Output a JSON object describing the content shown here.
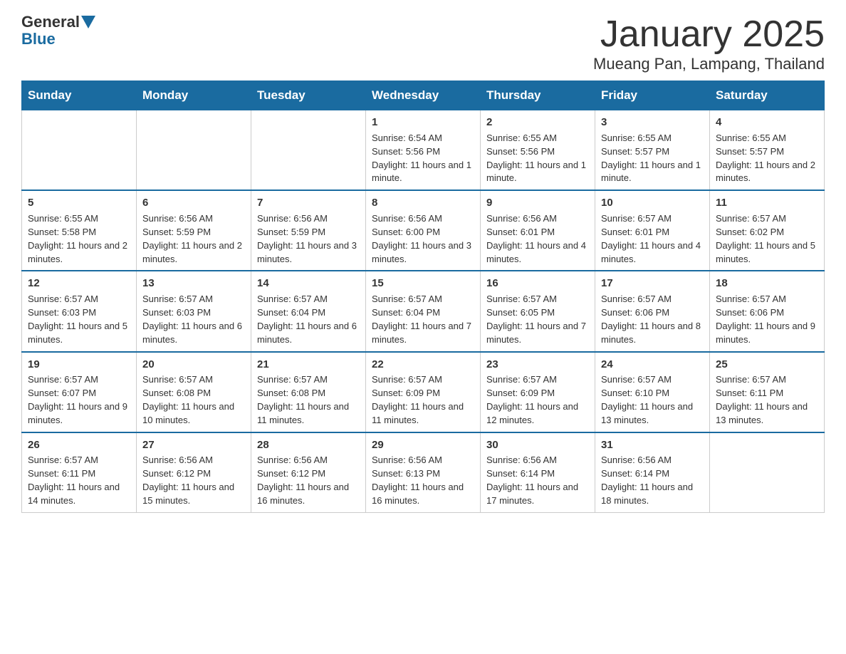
{
  "logo": {
    "general": "General",
    "blue": "Blue"
  },
  "title": "January 2025",
  "subtitle": "Mueang Pan, Lampang, Thailand",
  "weekdays": [
    "Sunday",
    "Monday",
    "Tuesday",
    "Wednesday",
    "Thursday",
    "Friday",
    "Saturday"
  ],
  "weeks": [
    [
      {
        "day": "",
        "info": ""
      },
      {
        "day": "",
        "info": ""
      },
      {
        "day": "",
        "info": ""
      },
      {
        "day": "1",
        "info": "Sunrise: 6:54 AM\nSunset: 5:56 PM\nDaylight: 11 hours and 1 minute."
      },
      {
        "day": "2",
        "info": "Sunrise: 6:55 AM\nSunset: 5:56 PM\nDaylight: 11 hours and 1 minute."
      },
      {
        "day": "3",
        "info": "Sunrise: 6:55 AM\nSunset: 5:57 PM\nDaylight: 11 hours and 1 minute."
      },
      {
        "day": "4",
        "info": "Sunrise: 6:55 AM\nSunset: 5:57 PM\nDaylight: 11 hours and 2 minutes."
      }
    ],
    [
      {
        "day": "5",
        "info": "Sunrise: 6:55 AM\nSunset: 5:58 PM\nDaylight: 11 hours and 2 minutes."
      },
      {
        "day": "6",
        "info": "Sunrise: 6:56 AM\nSunset: 5:59 PM\nDaylight: 11 hours and 2 minutes."
      },
      {
        "day": "7",
        "info": "Sunrise: 6:56 AM\nSunset: 5:59 PM\nDaylight: 11 hours and 3 minutes."
      },
      {
        "day": "8",
        "info": "Sunrise: 6:56 AM\nSunset: 6:00 PM\nDaylight: 11 hours and 3 minutes."
      },
      {
        "day": "9",
        "info": "Sunrise: 6:56 AM\nSunset: 6:01 PM\nDaylight: 11 hours and 4 minutes."
      },
      {
        "day": "10",
        "info": "Sunrise: 6:57 AM\nSunset: 6:01 PM\nDaylight: 11 hours and 4 minutes."
      },
      {
        "day": "11",
        "info": "Sunrise: 6:57 AM\nSunset: 6:02 PM\nDaylight: 11 hours and 5 minutes."
      }
    ],
    [
      {
        "day": "12",
        "info": "Sunrise: 6:57 AM\nSunset: 6:03 PM\nDaylight: 11 hours and 5 minutes."
      },
      {
        "day": "13",
        "info": "Sunrise: 6:57 AM\nSunset: 6:03 PM\nDaylight: 11 hours and 6 minutes."
      },
      {
        "day": "14",
        "info": "Sunrise: 6:57 AM\nSunset: 6:04 PM\nDaylight: 11 hours and 6 minutes."
      },
      {
        "day": "15",
        "info": "Sunrise: 6:57 AM\nSunset: 6:04 PM\nDaylight: 11 hours and 7 minutes."
      },
      {
        "day": "16",
        "info": "Sunrise: 6:57 AM\nSunset: 6:05 PM\nDaylight: 11 hours and 7 minutes."
      },
      {
        "day": "17",
        "info": "Sunrise: 6:57 AM\nSunset: 6:06 PM\nDaylight: 11 hours and 8 minutes."
      },
      {
        "day": "18",
        "info": "Sunrise: 6:57 AM\nSunset: 6:06 PM\nDaylight: 11 hours and 9 minutes."
      }
    ],
    [
      {
        "day": "19",
        "info": "Sunrise: 6:57 AM\nSunset: 6:07 PM\nDaylight: 11 hours and 9 minutes."
      },
      {
        "day": "20",
        "info": "Sunrise: 6:57 AM\nSunset: 6:08 PM\nDaylight: 11 hours and 10 minutes."
      },
      {
        "day": "21",
        "info": "Sunrise: 6:57 AM\nSunset: 6:08 PM\nDaylight: 11 hours and 11 minutes."
      },
      {
        "day": "22",
        "info": "Sunrise: 6:57 AM\nSunset: 6:09 PM\nDaylight: 11 hours and 11 minutes."
      },
      {
        "day": "23",
        "info": "Sunrise: 6:57 AM\nSunset: 6:09 PM\nDaylight: 11 hours and 12 minutes."
      },
      {
        "day": "24",
        "info": "Sunrise: 6:57 AM\nSunset: 6:10 PM\nDaylight: 11 hours and 13 minutes."
      },
      {
        "day": "25",
        "info": "Sunrise: 6:57 AM\nSunset: 6:11 PM\nDaylight: 11 hours and 13 minutes."
      }
    ],
    [
      {
        "day": "26",
        "info": "Sunrise: 6:57 AM\nSunset: 6:11 PM\nDaylight: 11 hours and 14 minutes."
      },
      {
        "day": "27",
        "info": "Sunrise: 6:56 AM\nSunset: 6:12 PM\nDaylight: 11 hours and 15 minutes."
      },
      {
        "day": "28",
        "info": "Sunrise: 6:56 AM\nSunset: 6:12 PM\nDaylight: 11 hours and 16 minutes."
      },
      {
        "day": "29",
        "info": "Sunrise: 6:56 AM\nSunset: 6:13 PM\nDaylight: 11 hours and 16 minutes."
      },
      {
        "day": "30",
        "info": "Sunrise: 6:56 AM\nSunset: 6:14 PM\nDaylight: 11 hours and 17 minutes."
      },
      {
        "day": "31",
        "info": "Sunrise: 6:56 AM\nSunset: 6:14 PM\nDaylight: 11 hours and 18 minutes."
      },
      {
        "day": "",
        "info": ""
      }
    ]
  ]
}
